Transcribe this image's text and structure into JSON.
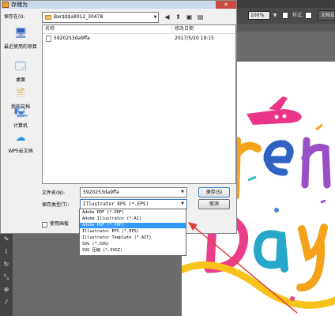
{
  "dialog": {
    "title": "存储为",
    "close_glyph": "✕",
    "save_in_label": "保存在(I):",
    "save_in_value": "Bar$$$all012_30478",
    "places": [
      {
        "label": "最近使用的项目",
        "icon": "recent-places-icon",
        "glyph": "🖥"
      },
      {
        "label": "桌面",
        "icon": "desktop-icon",
        "glyph": "🗔"
      },
      {
        "label": "我的文档",
        "icon": "documents-icon",
        "glyph": "🗎"
      },
      {
        "label": "计算机",
        "icon": "computer-icon",
        "glyph": "🖳"
      },
      {
        "label": "WPS云文档",
        "icon": "cloud-icon",
        "glyph": "☁"
      }
    ],
    "columns": {
      "name": "名称",
      "date": "修改日期"
    },
    "files": [
      {
        "name": "5920253da9ffa",
        "date": "2017/5/20 19:15"
      }
    ],
    "filename_label": "文件名(N):",
    "filename_value": "5920253da9ffa",
    "savetype_label": "保存类型(T):",
    "savetype_value": "Illustrator EPS (*.EPS)",
    "save_button": "保存(S)",
    "cancel_button": "取消",
    "use_artboards_label": "使用画板",
    "format_options": [
      "Adobe PDF (*.PDF)",
      "Adobe Illustrator (*.AI)",
      "Adobe PDF (*.PDF)",
      "Illustrator EPS (*.EPS)",
      "Illustrator Template (*.AIT)",
      "SVG (*.SVG)",
      "SVG 压缩 (*.SVGZ)"
    ],
    "selected_format_index": 2
  },
  "toolbar": {
    "zoom": "100%",
    "style_label": "样式:",
    "doc_settings": "文档设置"
  },
  "colors": {
    "annotation_arrow": "#e0403a",
    "selection": "#3399ff"
  }
}
